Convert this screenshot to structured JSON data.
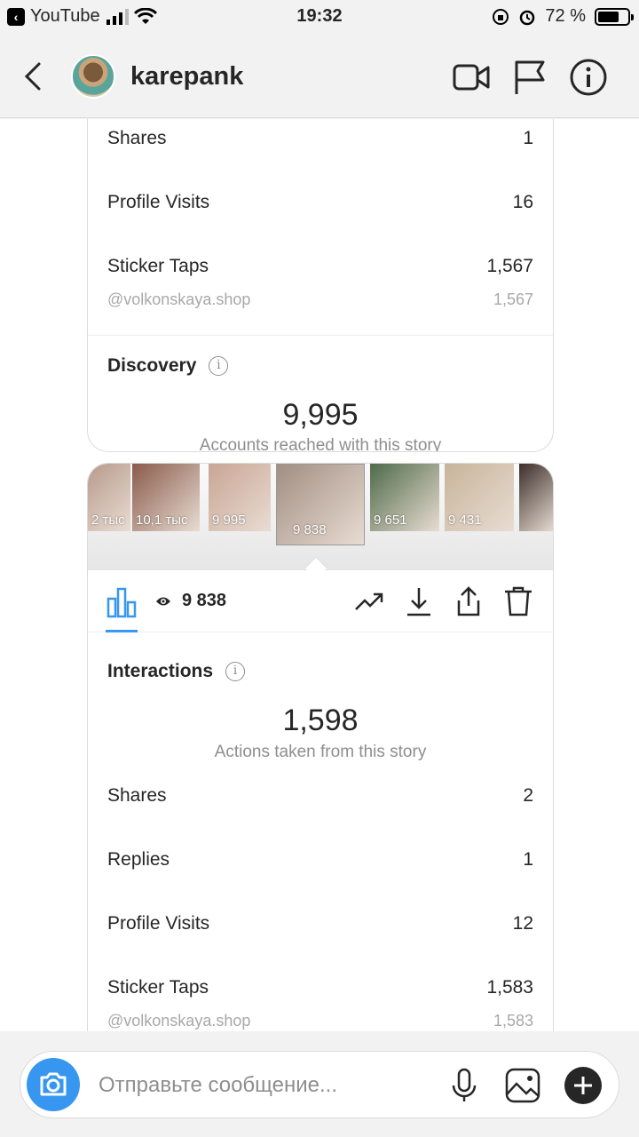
{
  "status_bar": {
    "back_app": "YouTube",
    "time": "19:32",
    "battery": "72 %",
    "battery_level": 0.72
  },
  "header": {
    "username": "karepank"
  },
  "top_card": {
    "rows": [
      {
        "label": "Shares",
        "value": "1"
      },
      {
        "label": "Profile Visits",
        "value": "16"
      },
      {
        "label": "Sticker Taps",
        "value": "1,567"
      }
    ],
    "sticker_sub": {
      "label": "@volkonskaya.shop",
      "value": "1,567"
    },
    "discovery_title": "Discovery",
    "discovery_value": "9,995",
    "discovery_caption": "Accounts reached with this story"
  },
  "thumbnails": [
    {
      "label": "2 тыс",
      "color": "#b89a8c"
    },
    {
      "label": "10,1 тыс",
      "color": "#8a5b4c"
    },
    {
      "label": "9 995",
      "color": "#c9a595"
    },
    {
      "label": "9 838",
      "color": "#a28e82"
    },
    {
      "label": "9 651",
      "color": "#4f6b4a"
    },
    {
      "label": "9 431",
      "color": "#c7b49a"
    },
    {
      "label": "",
      "color": "#3c2e2a"
    }
  ],
  "toolbar": {
    "views": "9 838"
  },
  "bottom_card": {
    "interactions_title": "Interactions",
    "interactions_value": "1,598",
    "interactions_caption": "Actions taken from this story",
    "rows": [
      {
        "label": "Shares",
        "value": "2"
      },
      {
        "label": "Replies",
        "value": "1"
      },
      {
        "label": "Profile Visits",
        "value": "12"
      },
      {
        "label": "Sticker Taps",
        "value": "1,583"
      }
    ],
    "sticker_sub": {
      "label": "@volkonskaya.shop",
      "value": "1,583"
    }
  },
  "composer": {
    "placeholder": "Отправьте сообщение..."
  },
  "colors": {
    "accent": "#3797f0",
    "text": "#262626",
    "muted": "#8e8e8e"
  }
}
